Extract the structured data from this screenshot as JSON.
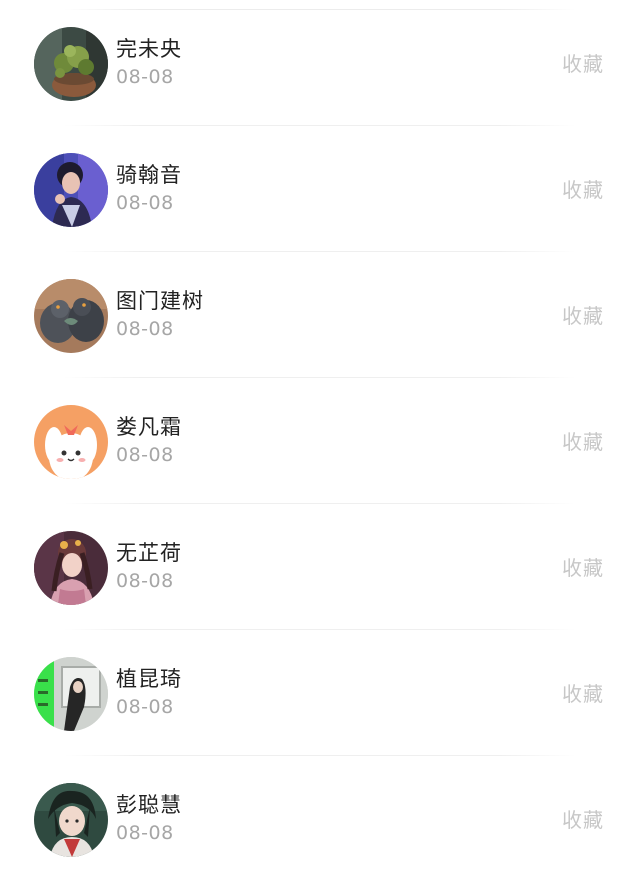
{
  "collect_label": "收藏",
  "items": [
    {
      "name": "完未央",
      "date": "08-08",
      "avatar": "potted-plant-avatar"
    },
    {
      "name": "骑翰音",
      "date": "08-08",
      "avatar": "girl-portrait-avatar"
    },
    {
      "name": "图门建树",
      "date": "08-08",
      "avatar": "pigeons-avatar"
    },
    {
      "name": "娄凡霜",
      "date": "08-08",
      "avatar": "cartoon-bunny-avatar"
    },
    {
      "name": "无芷荷",
      "date": "08-08",
      "avatar": "anime-girl-avatar"
    },
    {
      "name": "植昆琦",
      "date": "08-08",
      "avatar": "window-girl-avatar"
    },
    {
      "name": "彭聪慧",
      "date": "08-08",
      "avatar": "anime-boy-avatar"
    }
  ]
}
